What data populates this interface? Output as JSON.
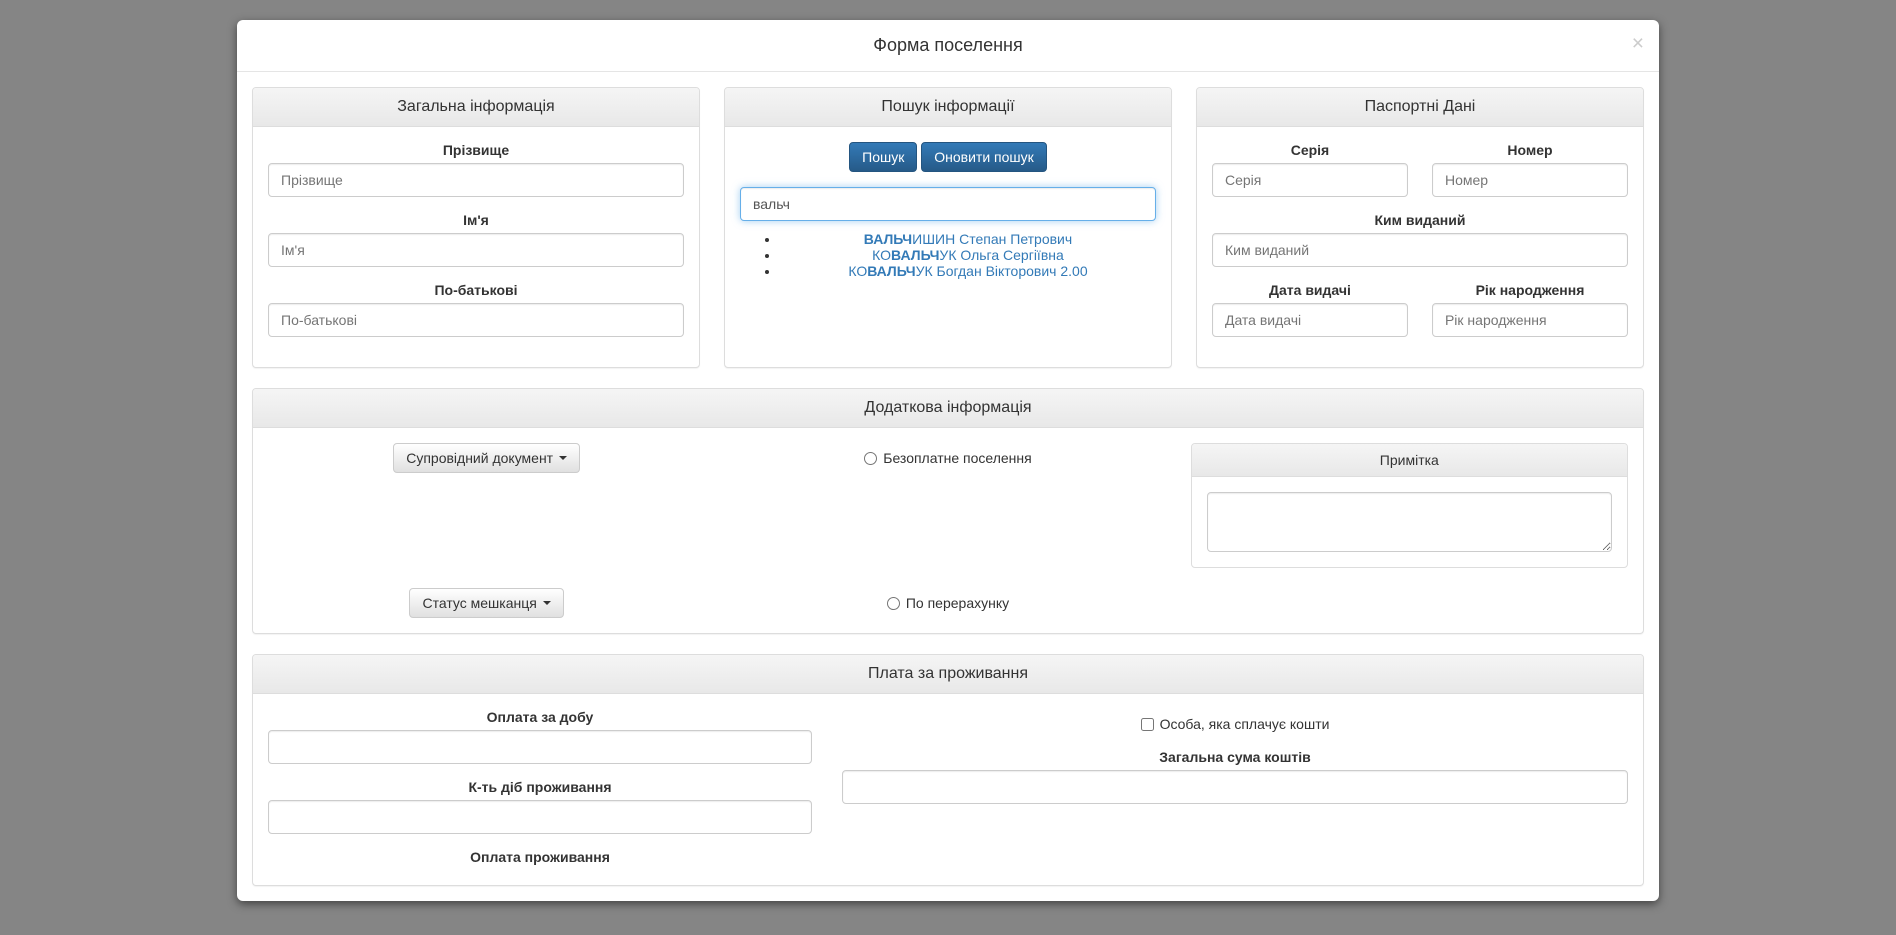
{
  "modal": {
    "title": "Форма поселення",
    "close_symbol": "×"
  },
  "panels": {
    "general": {
      "title": "Загальна інформація",
      "surname_label": "Прізвище",
      "surname_placeholder": "Прізвище",
      "name_label": "Ім'я",
      "name_placeholder": "Ім'я",
      "patronymic_label": "По-батькові",
      "patronymic_placeholder": "По-батькові"
    },
    "search": {
      "title": "Пошук інформації",
      "search_btn": "Пошук",
      "refresh_btn": "Оновити пошук",
      "query_value": "вальч",
      "results": [
        {
          "bold": "ВАЛЬЧ",
          "rest": "ИШИН Степан Петрович"
        },
        {
          "prefix": "КО",
          "bold": "ВАЛЬЧ",
          "rest": "УК Ольга Сергіївна"
        },
        {
          "prefix": "КО",
          "bold": "ВАЛЬЧ",
          "rest": "УК Богдан Вікторович 2.00"
        }
      ]
    },
    "passport": {
      "title": "Паспортні Дані",
      "series_label": "Серія",
      "series_placeholder": "Серія",
      "number_label": "Номер",
      "number_placeholder": "Номер",
      "issued_by_label": "Ким виданий",
      "issued_by_placeholder": "Ким виданий",
      "issue_date_label": "Дата видачі",
      "issue_date_placeholder": "Дата видачі",
      "birth_year_label": "Рік народження",
      "birth_year_placeholder": "Рік народження"
    },
    "additional": {
      "title": "Додаткова інформація",
      "doc_dropdown": "Супровідний документ",
      "free_settlement": "Безоплатне поселення",
      "note_title": "Примітка",
      "status_dropdown": "Статус мешканця",
      "by_recalc": "По перерахунку"
    },
    "payment": {
      "title": "Плата за проживання",
      "per_day_label": "Оплата за добу",
      "days_label": "К-ть діб проживання",
      "total_payment_label": "Оплата проживання",
      "payer_label": "Особа, яка сплачує кошти",
      "total_sum_label": "Загальна сума коштів"
    }
  }
}
